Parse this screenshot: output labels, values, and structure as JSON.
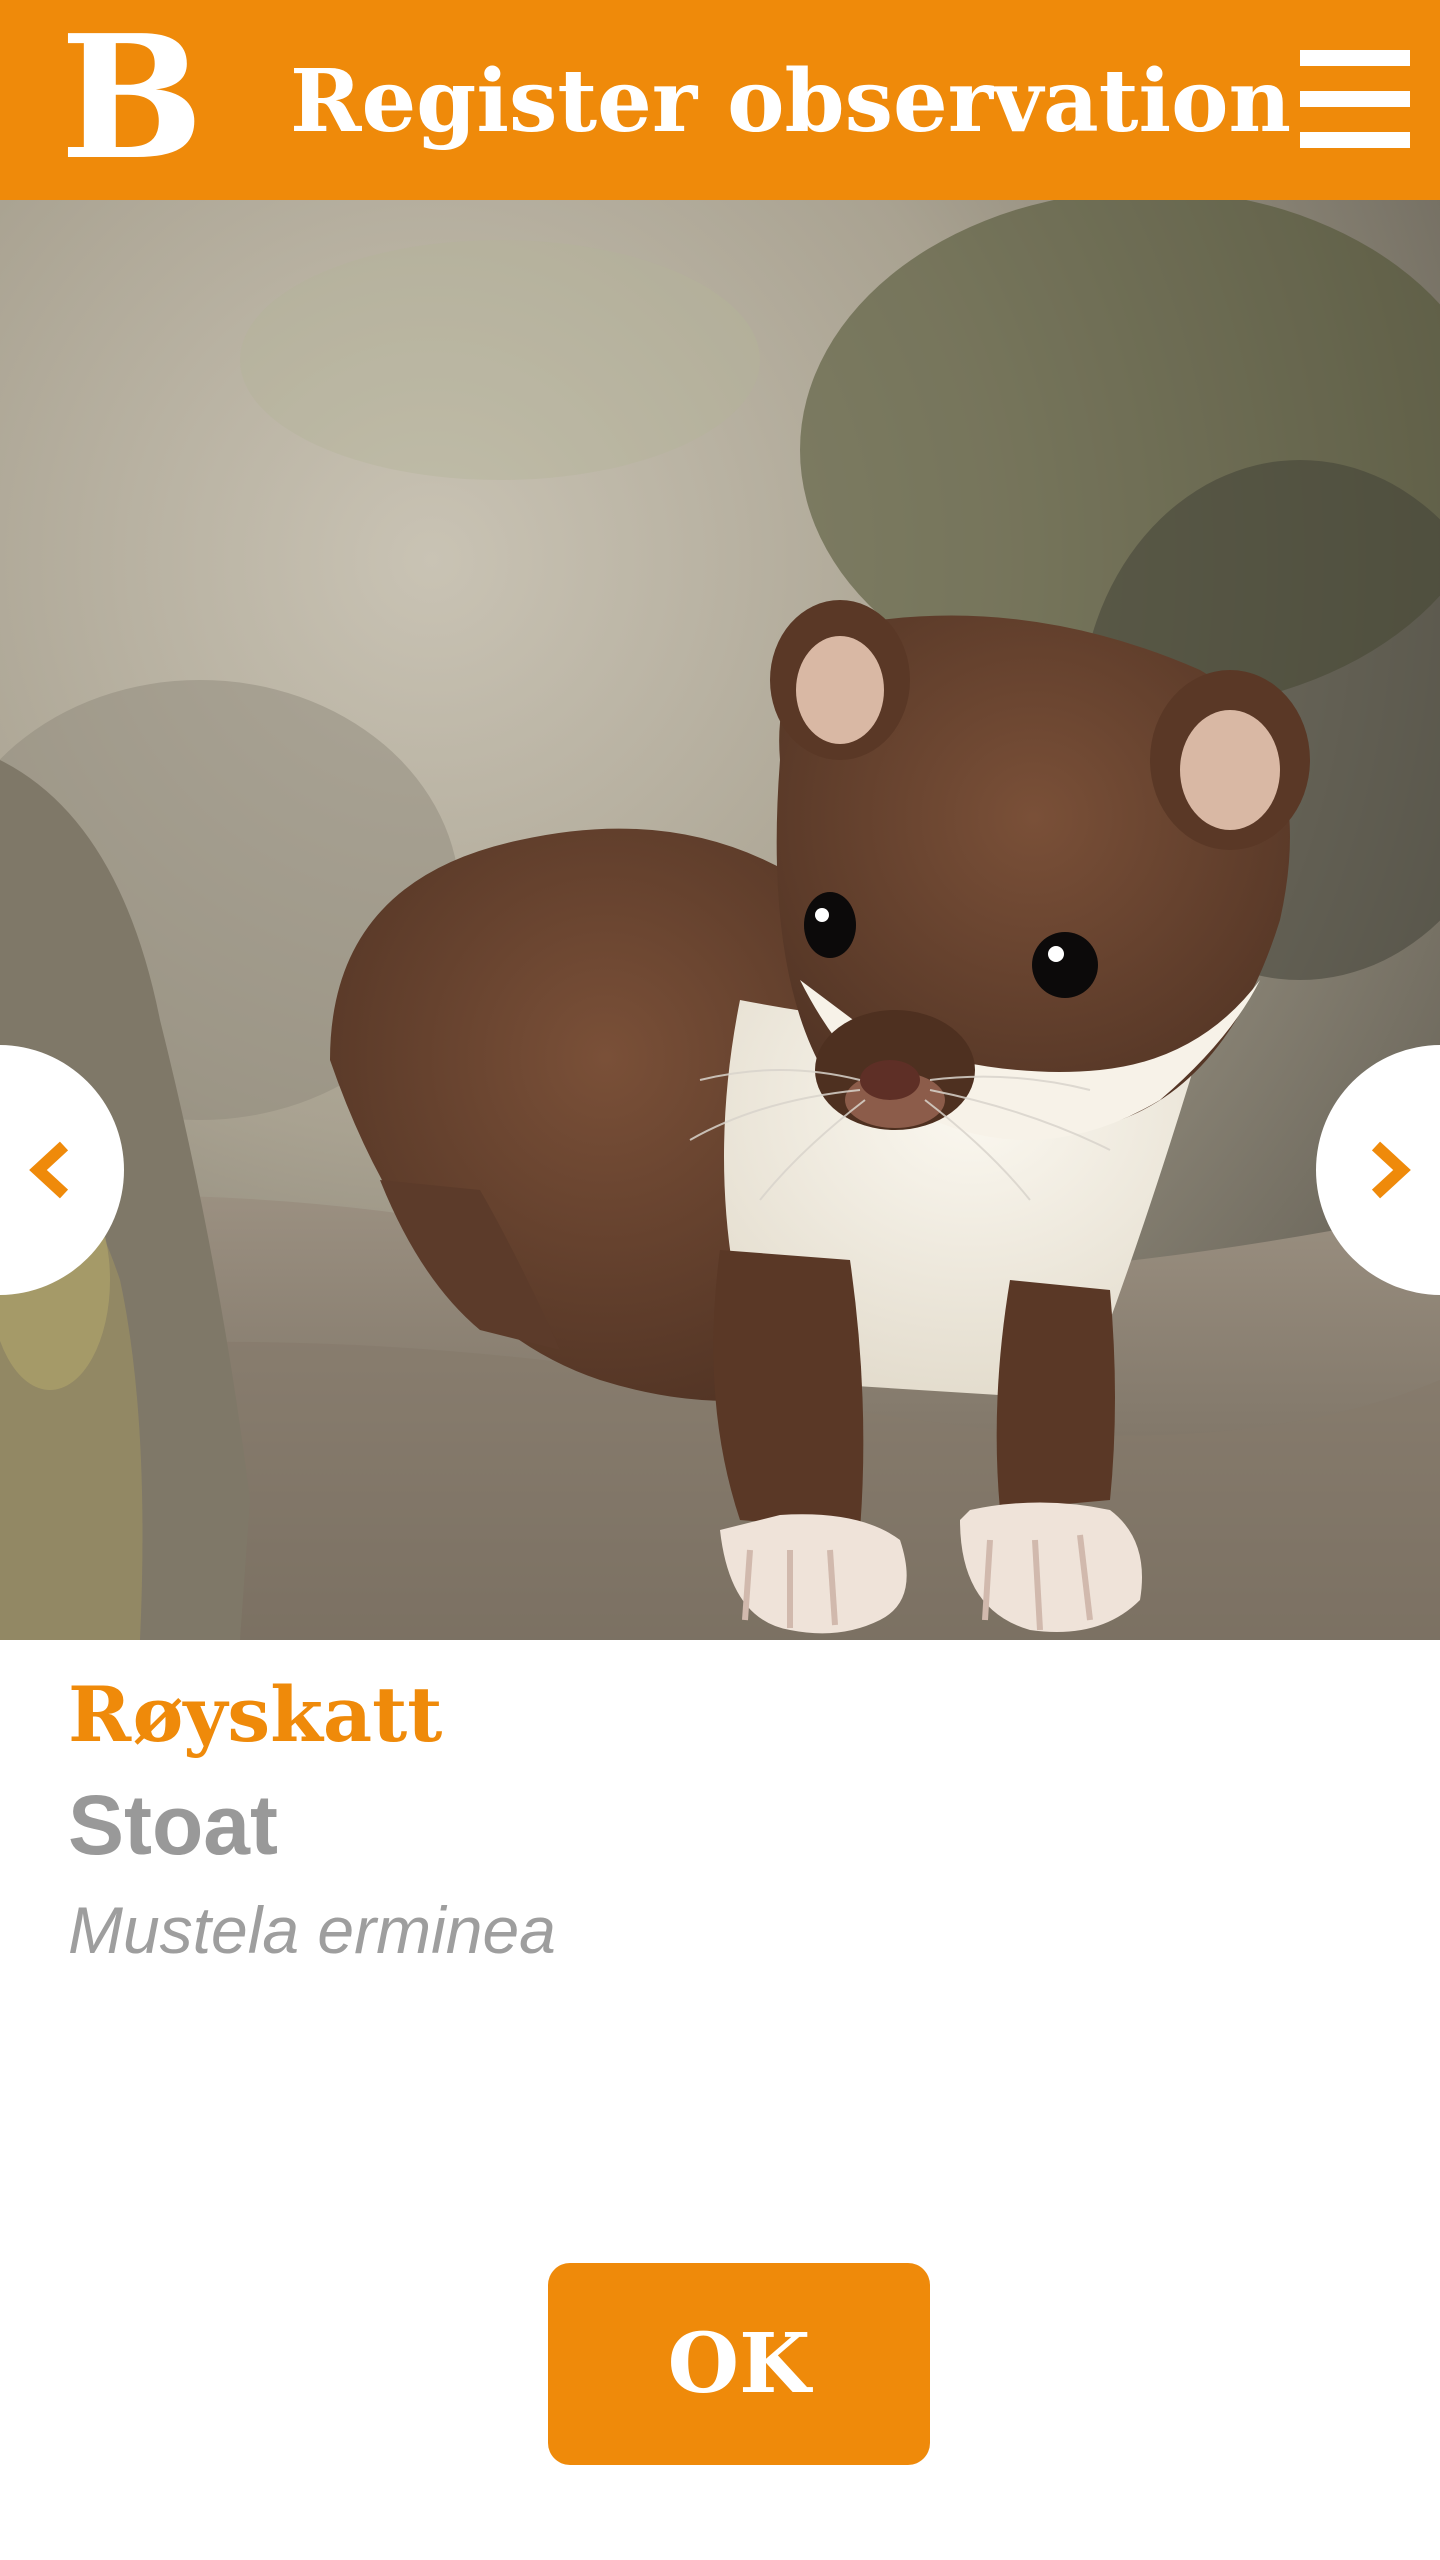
{
  "header": {
    "logo_text": "B",
    "title": "Register observation",
    "menu_icon": "hamburger-menu-icon"
  },
  "photo": {
    "subject": "stoat",
    "prev_icon": "chevron-left-icon",
    "next_icon": "chevron-right-icon"
  },
  "species": {
    "local_name": "Røyskatt",
    "english_name": "Stoat",
    "latin_name": "Mustela erminea"
  },
  "actions": {
    "ok_label": "OK"
  },
  "colors": {
    "accent": "#ef8a0a",
    "secondary_text": "#999999"
  }
}
